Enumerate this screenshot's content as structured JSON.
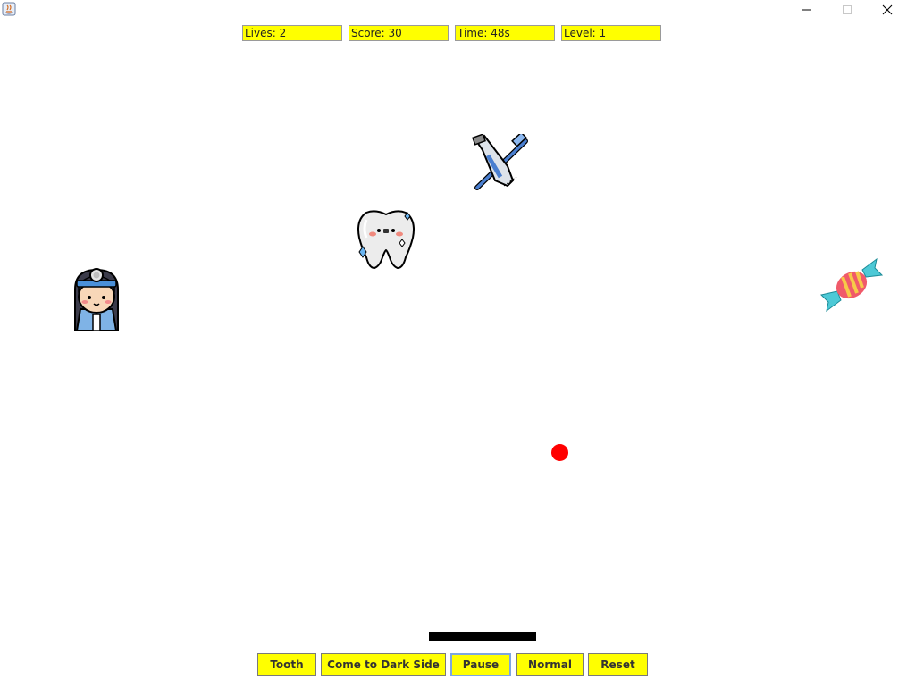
{
  "window": {
    "icons": [
      "java-icon",
      "minimize-icon",
      "maximize-icon",
      "close-icon"
    ]
  },
  "status": {
    "lives": "Lives: 2",
    "score": "Score: 30",
    "time": "Time: 48s",
    "level": "Level: 1"
  },
  "sprites": [
    "dentist",
    "tooth",
    "toothbrush-toothpaste",
    "candy"
  ],
  "colors": {
    "panel": "#ffff00",
    "ball": "#ff0000",
    "paddle": "#000000",
    "background": "#ffffff",
    "focus": "#7ea6e0"
  },
  "buttons": {
    "tooth": "Tooth",
    "dark_side": "Come to Dark Side",
    "pause": "Pause",
    "normal": "Normal",
    "reset": "Reset"
  }
}
